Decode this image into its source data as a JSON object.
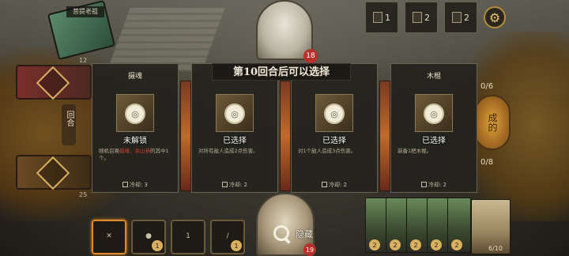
{
  "opponent": {
    "name": "菩提老祖",
    "deck_count": "12"
  },
  "resources": [
    {
      "icon": "hourglass-icon",
      "value": "1"
    },
    {
      "icon": "card-stack-icon",
      "value": "2"
    },
    {
      "icon": "book-icon",
      "value": "2"
    }
  ],
  "settings": {
    "icon": "gear-icon"
  },
  "enemy": {
    "hp": "18"
  },
  "player": {
    "hp": "19"
  },
  "deck": {
    "top_count": "12",
    "bottom_count": "25"
  },
  "round": {
    "label": "回合"
  },
  "right_side": {
    "top_counter": "0/6",
    "bottom_counter": "0/8",
    "seal_text": "成的"
  },
  "modal": {
    "title": "第10回合后可以选择",
    "panels": [
      {
        "title": "摄魂",
        "state": "未解锁",
        "desc_pre": "随机召唤",
        "desc_red": "鼓缕、余山参",
        "desc_post": "的其中1个。",
        "cooldown": "冷却: 3",
        "badge": "locked"
      },
      {
        "title": "",
        "state": "已选择",
        "desc_pre": "对所有敌人造成2点伤害。",
        "desc_red": "",
        "desc_post": "",
        "cooldown": "冷却: 2",
        "badge": "locked"
      },
      {
        "title": "",
        "state": "已选择",
        "desc_pre": "对1个敌人造成3点伤害。",
        "desc_red": "",
        "desc_post": "",
        "cooldown": "冷却: 2",
        "badge": "locked"
      },
      {
        "title": "木棍",
        "state": "已选择",
        "desc_pre": "装备1把木棍。",
        "desc_red": "",
        "desc_post": "",
        "cooldown": "冷却: 2",
        "badge": "locked"
      }
    ]
  },
  "hide_button": {
    "label": "隐藏",
    "icon": "magnifier-icon"
  },
  "skills": [
    {
      "icon": "crossed-weapons-icon",
      "text": "",
      "count": ""
    },
    {
      "icon": "stone-icon",
      "text": "",
      "count": "1"
    },
    {
      "icon": "hourglass-icon",
      "text": "1",
      "count": ""
    },
    {
      "icon": "sword-icon",
      "text": "",
      "count": "1"
    }
  ],
  "hand": {
    "costs": [
      "2",
      "2",
      "2",
      "2",
      "2"
    ],
    "count": "6/10"
  },
  "colors": {
    "accent": "#b48a3c",
    "hp_red": "#b8302a",
    "cost_gold": "#d8b060"
  }
}
